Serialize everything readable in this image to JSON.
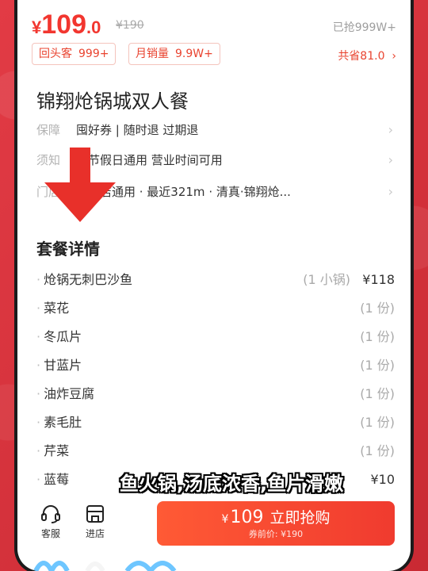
{
  "price": {
    "currency": "¥",
    "integer": "109",
    "decimal": ".0",
    "original": "¥190",
    "sold_label": "已抢999W+"
  },
  "tags": [
    {
      "label": "回头客",
      "value": "999+"
    },
    {
      "label": "月销量",
      "value": "9.9W+"
    }
  ],
  "savings": "共省81.0",
  "deal_title": "锦翔炝锅城双人餐",
  "info_rows": [
    {
      "label": "保障",
      "text": "囤好券 | 随时退  过期退"
    },
    {
      "label": "须知",
      "text": "末节假日通用  营业时间可用"
    },
    {
      "label": "门店",
      "text": "客门店通用 · 最近321m · 清真·锦翔炝..."
    }
  ],
  "section_title": "套餐详情",
  "package_items": [
    {
      "name": "炝锅无刺巴沙鱼",
      "qty": "(1 小锅)",
      "price": "¥118"
    },
    {
      "name": "菜花",
      "qty": "(1 份)",
      "price": ""
    },
    {
      "name": "冬瓜片",
      "qty": "(1 份)",
      "price": ""
    },
    {
      "name": "甘蓝片",
      "qty": "(1 份)",
      "price": ""
    },
    {
      "name": "油炸豆腐",
      "qty": "(1 份)",
      "price": ""
    },
    {
      "name": "素毛肚",
      "qty": "(1 份)",
      "price": ""
    },
    {
      "name": "芹菜",
      "qty": "(1 份)",
      "price": ""
    },
    {
      "name": "蓝莓",
      "qty": "",
      "price": "¥10"
    }
  ],
  "subtitle_caption": "鱼火锅,汤底浓香,鱼片滑嫩",
  "bottom_bar": {
    "service_label": "客服",
    "store_label": "进店",
    "buy": {
      "currency": "¥",
      "price": "109",
      "action": "立即抢购",
      "sub_label": "券前价: ¥190"
    }
  },
  "colors": {
    "accent": "#f2362f",
    "background": "#d8323a",
    "arrow": "#e8302a"
  },
  "icons": {
    "service": "headset-icon",
    "store": "store-icon",
    "chevron": "chevron-right-icon",
    "arrow": "down-arrow-icon"
  }
}
